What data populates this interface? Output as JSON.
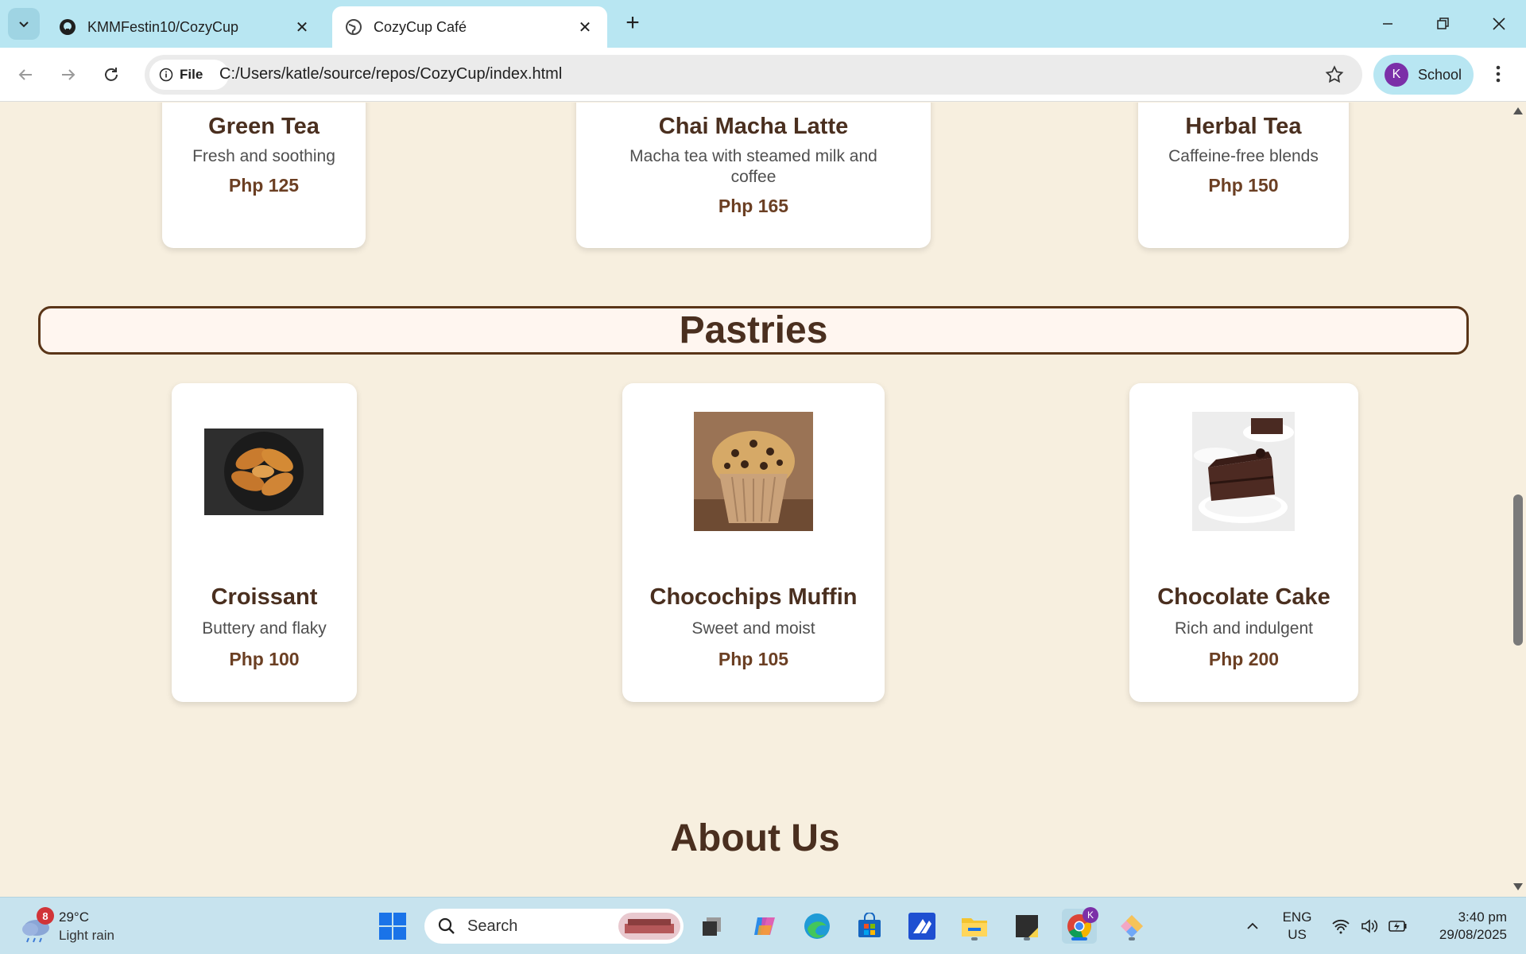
{
  "browser": {
    "tabs": [
      {
        "title": "KMMFestin10/CozyCup",
        "favicon": "github-icon",
        "active": false
      },
      {
        "title": "CozyCup Café",
        "favicon": "globe-icon",
        "active": true
      }
    ],
    "site_info_label": "File",
    "url": "C:/Users/katle/source/repos/CozyCup/index.html",
    "profile_initial": "K",
    "profile_label": "School"
  },
  "page": {
    "drinks_row": [
      {
        "name": "Green Tea",
        "desc": "Fresh and soothing",
        "price": "Php 125"
      },
      {
        "name": "Chai Macha Latte",
        "desc": "Macha tea with steamed milk and coffee",
        "price": "Php 165"
      },
      {
        "name": "Herbal Tea",
        "desc": "Caffeine-free blends",
        "price": "Php 150"
      }
    ],
    "pastries_heading": "Pastries",
    "pastries": [
      {
        "name": "Croissant",
        "desc": "Buttery and flaky",
        "price": "Php 100",
        "image": "croissant-image"
      },
      {
        "name": "Chocochips Muffin",
        "desc": "Sweet and moist",
        "price": "Php 105",
        "image": "muffin-image"
      },
      {
        "name": "Chocolate Cake",
        "desc": "Rich and indulgent",
        "price": "Php 200",
        "image": "chocolate-cake-image"
      }
    ],
    "about_heading": "About Us"
  },
  "taskbar": {
    "weather_temp": "29°C",
    "weather_desc": "Light rain",
    "weather_badge": "8",
    "search_label": "Search",
    "lang_top": "ENG",
    "lang_bottom": "US",
    "time": "3:40 pm",
    "date": "29/08/2025",
    "chrome_badge": "K"
  },
  "colors": {
    "page_bg": "#f7efdf",
    "heading_brown": "#4a2f1f",
    "price_brown": "#6b3f23",
    "tab_strip": "#b8e6f2",
    "taskbar": "#c7e3ee"
  }
}
